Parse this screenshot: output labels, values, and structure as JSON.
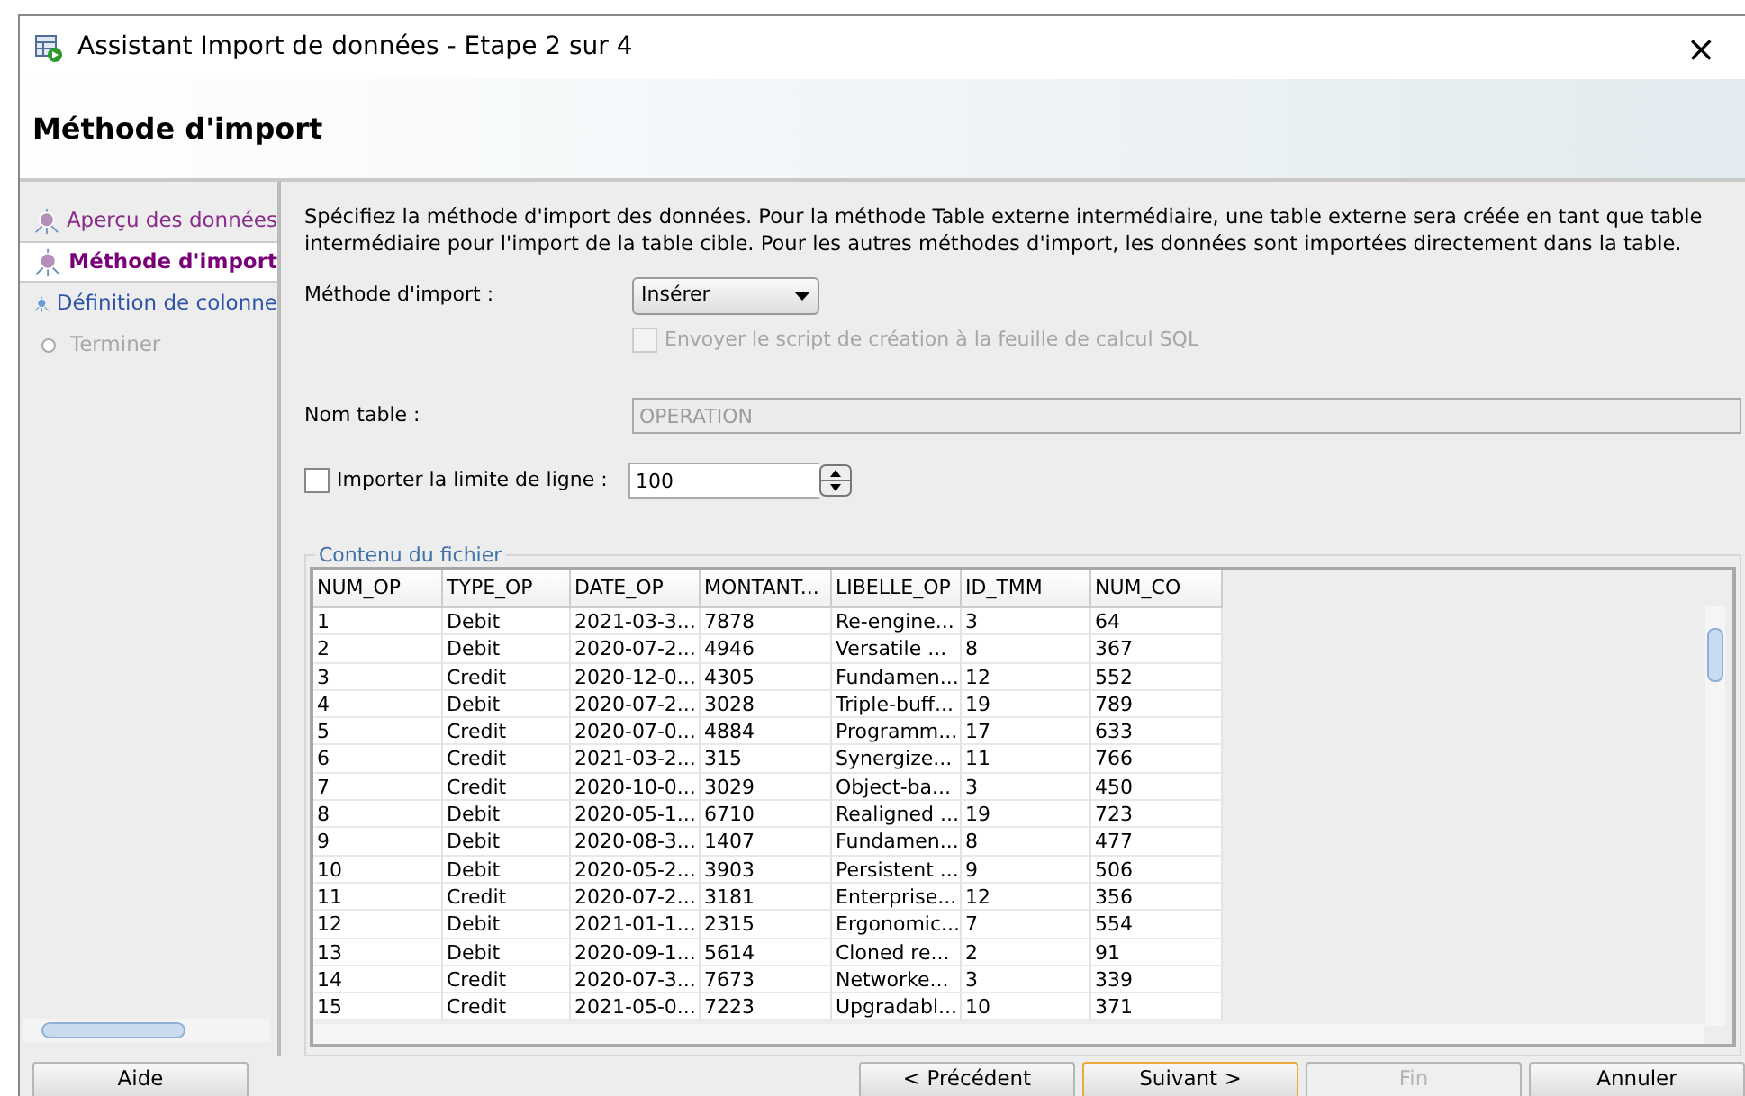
{
  "window": {
    "title": "Assistant Import de données - Etape 2 sur 4",
    "close": "×"
  },
  "header": {
    "title": "Méthode d'import"
  },
  "steps": [
    {
      "label": "Aperçu des données",
      "selected": false,
      "visited": true,
      "disabled": false
    },
    {
      "label": "Méthode d'import",
      "selected": true,
      "visited": true,
      "disabled": false
    },
    {
      "label": "Définition de colonne",
      "selected": false,
      "visited": false,
      "disabled": false
    },
    {
      "label": "Terminer",
      "selected": false,
      "visited": false,
      "disabled": true
    }
  ],
  "description": "Spécifiez la méthode d'import des données. Pour la méthode Table externe intermédiaire, une table externe sera créée en tant que table intermédiaire pour l'import de la table cible. Pour les autres méthodes d'import, les données sont importées directement dans la table.",
  "method": {
    "label": "Méthode d'import :",
    "value": "Insérer"
  },
  "send_script": {
    "label": "Envoyer le script de création à la feuille de calcul SQL",
    "checked": false,
    "disabled": true
  },
  "table_name": {
    "label": "Nom table :",
    "value": "OPERATION",
    "disabled": true
  },
  "row_limit": {
    "label": "Importer la limite de ligne :",
    "checked": false,
    "value": "100"
  },
  "file_content": {
    "title": "Contenu du fichier",
    "columns": [
      "NUM_OP",
      "TYPE_OP",
      "DATE_OP",
      "MONTANT...",
      "LIBELLE_OP",
      "ID_TMM",
      "NUM_CO"
    ],
    "rows": [
      [
        "1",
        "Debit",
        "2021-03-3...",
        "7878",
        "Re-engine...",
        "3",
        "64"
      ],
      [
        "2",
        "Debit",
        "2020-07-2...",
        "4946",
        "Versatile ...",
        "8",
        "367"
      ],
      [
        "3",
        "Credit",
        "2020-12-0...",
        "4305",
        "Fundamen...",
        "12",
        "552"
      ],
      [
        "4",
        "Debit",
        "2020-07-2...",
        "3028",
        "Triple-buff...",
        "19",
        "789"
      ],
      [
        "5",
        "Credit",
        "2020-07-0...",
        "4884",
        "Programm...",
        "17",
        "633"
      ],
      [
        "6",
        "Credit",
        "2021-03-2...",
        "315",
        "Synergize...",
        "11",
        "766"
      ],
      [
        "7",
        "Credit",
        "2020-10-0...",
        "3029",
        "Object-ba...",
        "3",
        "450"
      ],
      [
        "8",
        "Debit",
        "2020-05-1...",
        "6710",
        "Realigned ...",
        "19",
        "723"
      ],
      [
        "9",
        "Debit",
        "2020-08-3...",
        "1407",
        "Fundamen...",
        "8",
        "477"
      ],
      [
        "10",
        "Debit",
        "2020-05-2...",
        "3903",
        "Persistent ...",
        "9",
        "506"
      ],
      [
        "11",
        "Credit",
        "2020-07-2...",
        "3181",
        "Enterprise...",
        "12",
        "356"
      ],
      [
        "12",
        "Debit",
        "2021-01-1...",
        "2315",
        "Ergonomic...",
        "7",
        "554"
      ],
      [
        "13",
        "Debit",
        "2020-09-1...",
        "5614",
        "Cloned re...",
        "2",
        "91"
      ],
      [
        "14",
        "Credit",
        "2020-07-3...",
        "7673",
        "Networke...",
        "3",
        "339"
      ],
      [
        "15",
        "Credit",
        "2021-05-0...",
        "7223",
        "Upgradabl...",
        "10",
        "371"
      ]
    ]
  },
  "buttons": [
    {
      "label": "Aide",
      "disabled": false,
      "focused": false
    },
    {
      "label": "< Précédent",
      "disabled": false,
      "focused": false
    },
    {
      "label": "Suivant >",
      "disabled": false,
      "focused": true
    },
    {
      "label": "Fin",
      "disabled": true,
      "focused": false
    },
    {
      "label": "Annuler",
      "disabled": false,
      "focused": false
    }
  ]
}
